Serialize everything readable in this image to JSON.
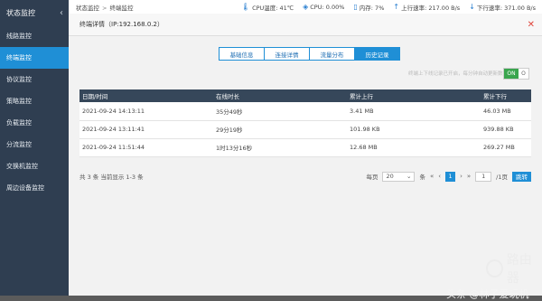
{
  "sidebar": {
    "header": "状态监控",
    "items": [
      {
        "label": "线路监控",
        "active": false
      },
      {
        "label": "终端监控",
        "active": true
      },
      {
        "label": "协议监控",
        "active": false
      },
      {
        "label": "策略监控",
        "active": false
      },
      {
        "label": "负载监控",
        "active": false
      },
      {
        "label": "分流监控",
        "active": false
      },
      {
        "label": "交换机监控",
        "active": false
      },
      {
        "label": "周边设备监控",
        "active": false
      }
    ]
  },
  "topbar": {
    "breadcrumb": [
      "状态监控",
      "终端监控"
    ],
    "cpu_temp": "CPU温度: 41℃",
    "cpu": "CPU: 0.00%",
    "memory": "内存: 7%",
    "upload": "上行速率: 217.00 B/s",
    "download": "下行速率: 371.00 B/s"
  },
  "modal": {
    "title": "终端详情（IP:192.168.0.2）",
    "tabs": [
      {
        "label": "基础信息",
        "active": false
      },
      {
        "label": "连接详情",
        "active": false
      },
      {
        "label": "流量分布",
        "active": false
      },
      {
        "label": "历史记录",
        "active": true
      }
    ],
    "notice": "终端上下线记录已开启，每分钟自动更新数据",
    "toggle_on": "ON",
    "toggle_off": "O",
    "columns": [
      "日期/时间",
      "在线时长",
      "累计上行",
      "累计下行"
    ],
    "rows": [
      [
        "2021-09-24 14:13:11",
        "35分49秒",
        "3.41 MB",
        "46.03 MB"
      ],
      [
        "2021-09-24 13:11:41",
        "29分19秒",
        "101.98 KB",
        "939.88 KB"
      ],
      [
        "2021-09-24 11:51:44",
        "1时13分16秒",
        "12.68 MB",
        "269.27 MB"
      ]
    ],
    "footer": {
      "summary": "共 3 条 当前显示 1-3 条",
      "per_page_label": "每页",
      "per_page": "20",
      "unit": "条",
      "current_page": "1",
      "page_input": "1",
      "total_pages": "/1页",
      "go": "跳转"
    }
  },
  "watermark": {
    "logo_text": "路由器",
    "credit": "头条 @林子爱玩机"
  }
}
